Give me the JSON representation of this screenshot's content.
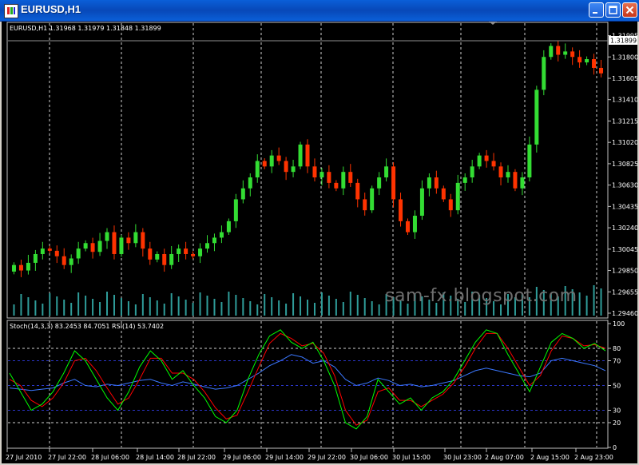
{
  "window": {
    "title": "EURUSD,H1"
  },
  "main_chart": {
    "info_label": "EURUSD,H1  1.31968 1.31979 1.31848 1.31899",
    "current_price_label": "1.31899",
    "price_axis_labels": [
      "1.31995",
      "1.31800",
      "1.31605",
      "1.31410",
      "1.31215",
      "1.31020",
      "1.30825",
      "1.30630",
      "1.30435",
      "1.30240",
      "1.30045",
      "1.29850",
      "1.29655",
      "1.29460"
    ],
    "colors": {
      "bull": "#33dd33",
      "bear": "#ff3300",
      "volume": "#2f9d9a",
      "grid": "#c0c0c0"
    }
  },
  "indicator": {
    "info_label": "Stoch(14,3,3) 83.2453 84.7051  RSI(14) 53.7402",
    "axis_labels": [
      "100",
      "80",
      "70",
      "50",
      "30",
      "20",
      "0"
    ],
    "colors": {
      "main": "#00ff00",
      "signal": "#ff0000",
      "rsi": "#3b78ff",
      "level_blue": "#2b36c9"
    }
  },
  "time_axis_labels": [
    "27 Jul 2010",
    "27 Jul 22:00",
    "28 Jul 06:00",
    "28 Jul 14:00",
    "28 Jul 22:00",
    "29 Jul 06:00",
    "29 Jul 14:00",
    "29 Jul 22:00",
    "30 Jul 06:00",
    "30 Jul 15:00",
    "30 Jul 23:00",
    "2 Aug 07:00",
    "2 Aug 15:00",
    "2 Aug 23:00"
  ],
  "watermark": "sam-fx.blogspot.com",
  "chart_data": {
    "type": "candlestick",
    "symbol": "EURUSD",
    "timeframe": "H1",
    "ohlc_last": {
      "open": 1.31968,
      "high": 1.31979,
      "low": 1.31848,
      "close": 1.31899
    },
    "ylim": [
      1.2946,
      1.3205
    ],
    "close_series": [
      1.299,
      1.2985,
      1.2992,
      1.3,
      1.3005,
      1.3003,
      1.2998,
      1.299,
      1.2996,
      1.3005,
      1.301,
      1.3002,
      1.3012,
      1.302,
      1.3,
      1.3015,
      1.301,
      1.302,
      1.3005,
      1.2995,
      1.3,
      1.299,
      1.3,
      1.3005,
      1.3,
      1.2998,
      1.3005,
      1.301,
      1.3015,
      1.302,
      1.303,
      1.305,
      1.306,
      1.307,
      1.3085,
      1.308,
      1.309,
      1.3085,
      1.3075,
      1.308,
      1.31,
      1.308,
      1.307,
      1.3075,
      1.3065,
      1.306,
      1.3075,
      1.3065,
      1.305,
      1.304,
      1.306,
      1.307,
      1.308,
      1.305,
      1.303,
      1.302,
      1.3035,
      1.306,
      1.307,
      1.306,
      1.305,
      1.304,
      1.3065,
      1.307,
      1.308,
      1.309,
      1.3085,
      1.308,
      1.307,
      1.3075,
      1.306,
      1.307,
      1.31,
      1.315,
      1.318,
      1.319,
      1.3182,
      1.3185,
      1.318,
      1.3175,
      1.3178,
      1.317,
      1.3165
    ],
    "stochastic": {
      "params": "14,3,3",
      "main_last": 83.2453,
      "signal_last": 84.7051,
      "main": [
        60,
        45,
        30,
        35,
        45,
        60,
        78,
        70,
        55,
        40,
        30,
        45,
        65,
        78,
        70,
        55,
        62,
        50,
        40,
        25,
        20,
        30,
        55,
        75,
        90,
        95,
        85,
        80,
        85,
        70,
        50,
        20,
        15,
        25,
        55,
        45,
        35,
        40,
        30,
        40,
        45,
        55,
        70,
        85,
        95,
        92,
        75,
        60,
        45,
        65,
        85,
        92,
        88,
        80,
        84,
        78
      ],
      "signal": [
        55,
        50,
        38,
        33,
        40,
        52,
        70,
        72,
        62,
        48,
        35,
        40,
        55,
        72,
        72,
        60,
        60,
        55,
        45,
        32,
        23,
        26,
        45,
        65,
        84,
        92,
        88,
        82,
        84,
        76,
        58,
        30,
        18,
        22,
        45,
        48,
        38,
        38,
        33,
        38,
        43,
        52,
        65,
        80,
        92,
        92,
        80,
        65,
        50,
        58,
        78,
        90,
        88,
        82,
        83,
        80
      ],
      "levels": [
        80,
        20
      ]
    },
    "rsi": {
      "period": 14,
      "last": 53.7402,
      "values": [
        48,
        47,
        46,
        47,
        48,
        52,
        55,
        50,
        49,
        51,
        50,
        52,
        54,
        55,
        52,
        50,
        53,
        51,
        49,
        47,
        48,
        50,
        55,
        60,
        66,
        70,
        75,
        73,
        68,
        70,
        65,
        55,
        50,
        52,
        56,
        54,
        50,
        51,
        49,
        50,
        52,
        54,
        58,
        62,
        64,
        62,
        60,
        58,
        57,
        60,
        70,
        72,
        70,
        68,
        66,
        62
      ],
      "levels": [
        70,
        50,
        30
      ]
    }
  }
}
